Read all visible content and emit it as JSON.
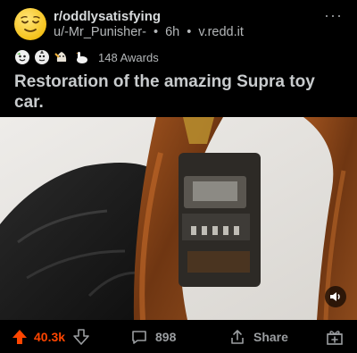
{
  "post": {
    "subreddit": "r/oddlysatisfying",
    "author": "u/-Mr_Punisher-",
    "age": "6h",
    "domain": "v.redd.it",
    "separator": "•",
    "awards_count": "148 Awards",
    "award_icons": [
      "wholesome-award-icon",
      "rocket-award-icon",
      "hugz-award-icon",
      "goose-award-icon"
    ],
    "title": "Restoration of the amazing Supra toy car."
  },
  "actions": {
    "score": "40.3k",
    "comments": "898",
    "share": "Share"
  },
  "colors": {
    "background": "#000000",
    "upvote": "#ff4500",
    "text": "#d7dadc",
    "muted": "#9a9da0"
  }
}
